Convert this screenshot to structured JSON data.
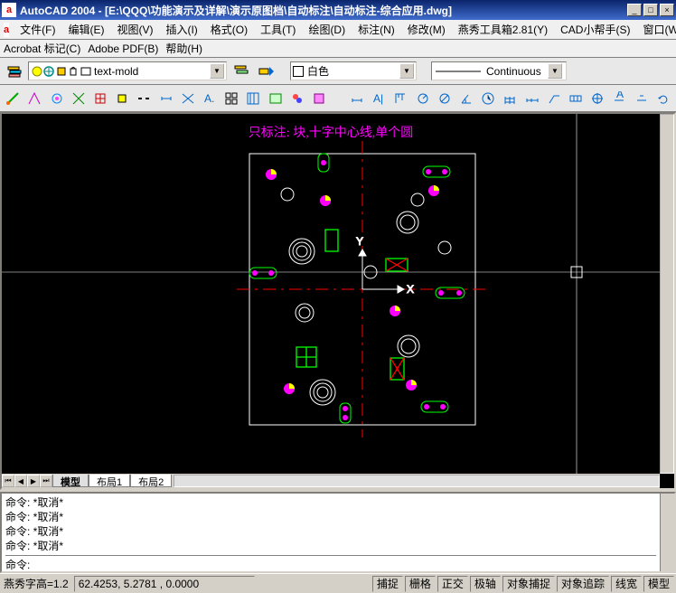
{
  "app_icon": "a",
  "title": "AutoCAD 2004 - [E:\\QQQ\\功能演示及详解\\演示原图档\\自动标注\\自动标注-综合应用.dwg]",
  "menus": [
    {
      "label": "文件(F)"
    },
    {
      "label": "编辑(E)"
    },
    {
      "label": "视图(V)"
    },
    {
      "label": "插入(I)"
    },
    {
      "label": "格式(O)"
    },
    {
      "label": "工具(T)"
    },
    {
      "label": "绘图(D)"
    },
    {
      "label": "标注(N)"
    },
    {
      "label": "修改(M)"
    },
    {
      "label": "燕秀工具箱2.81(Y)"
    },
    {
      "label": "CAD小帮手(S)"
    },
    {
      "label": "窗口(W)"
    }
  ],
  "menuline2": [
    {
      "label": "Acrobat 标记(C)"
    },
    {
      "label": "Adobe PDF(B)"
    },
    {
      "label": "帮助(H)"
    }
  ],
  "layer": {
    "current": "text-mold"
  },
  "color": {
    "swatch": "#ffffff",
    "label": "白色"
  },
  "linetype": {
    "label": "Continuous"
  },
  "annotation": "只标注: 块,十字中心线,单个圆",
  "tabs": [
    {
      "label": "模型",
      "active": true
    },
    {
      "label": "布局1",
      "active": false
    },
    {
      "label": "布局2",
      "active": false
    }
  ],
  "cmd_history": [
    "命令: *取消*",
    "命令: *取消*",
    "命令: *取消*",
    "命令: *取消*"
  ],
  "cmd_prompt": "命令:",
  "status": {
    "left_label": "燕秀字高=1.2",
    "coords": "62.4253,  5.2781 , 0.0000",
    "toggles": [
      "捕捉",
      "栅格",
      "正交",
      "极轴",
      "对象捕捉",
      "对象追踪",
      "线宽",
      "模型"
    ]
  },
  "icons": {
    "bulb_on": "●",
    "bulb_off": "○",
    "freeze": "❄",
    "lock": "🔒"
  }
}
